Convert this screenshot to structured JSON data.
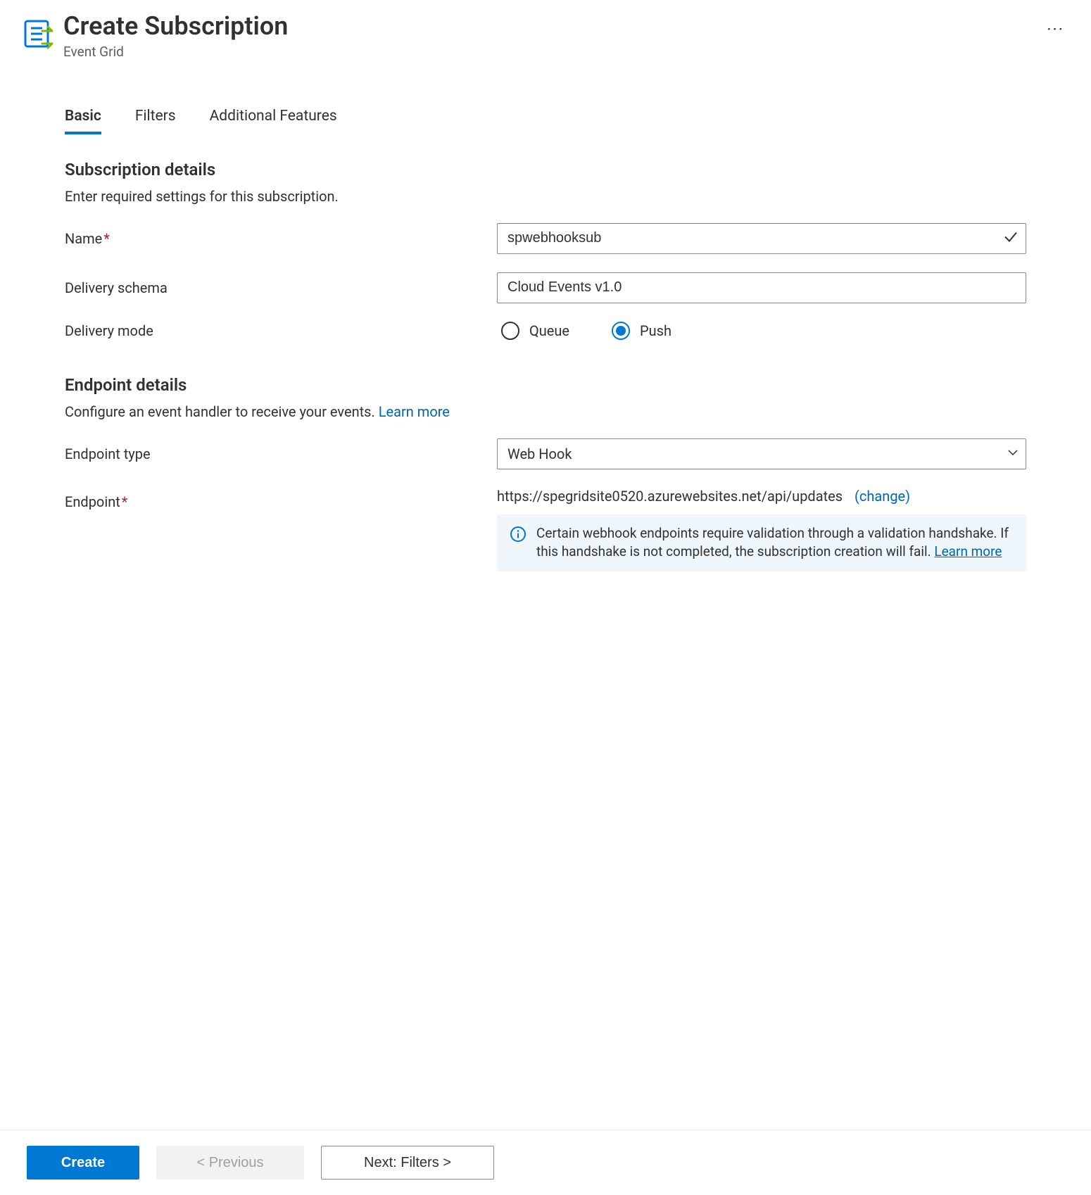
{
  "header": {
    "title": "Create Subscription",
    "subtitle": "Event Grid"
  },
  "tabs": [
    {
      "label": "Basic",
      "active": true
    },
    {
      "label": "Filters",
      "active": false
    },
    {
      "label": "Additional Features",
      "active": false
    }
  ],
  "subscription": {
    "section_title": "Subscription details",
    "section_desc": "Enter required settings for this subscription.",
    "name_label": "Name",
    "name_value": "spwebhooksub",
    "delivery_schema_label": "Delivery schema",
    "delivery_schema_value": "Cloud Events v1.0",
    "delivery_mode_label": "Delivery mode",
    "mode_queue_label": "Queue",
    "mode_push_label": "Push"
  },
  "endpoint": {
    "section_title": "Endpoint details",
    "section_desc": "Configure an event handler to receive your events. ",
    "learn_more": "Learn more",
    "type_label": "Endpoint type",
    "type_value": "Web Hook",
    "endpoint_label": "Endpoint",
    "endpoint_value": "https://spegridsite0520.azurewebsites.net/api/updates",
    "change_label": "change",
    "info_text": "Certain webhook endpoints require validation through a validation handshake. If this handshake is not completed, the subscription creation will fail.  ",
    "info_learn_more": "Learn more"
  },
  "footer": {
    "create": "Create",
    "previous": "< Previous",
    "next": "Next: Filters >"
  },
  "colors": {
    "primary": "#0078d4",
    "link": "#0065b3",
    "info_bg": "#eff6fc"
  }
}
